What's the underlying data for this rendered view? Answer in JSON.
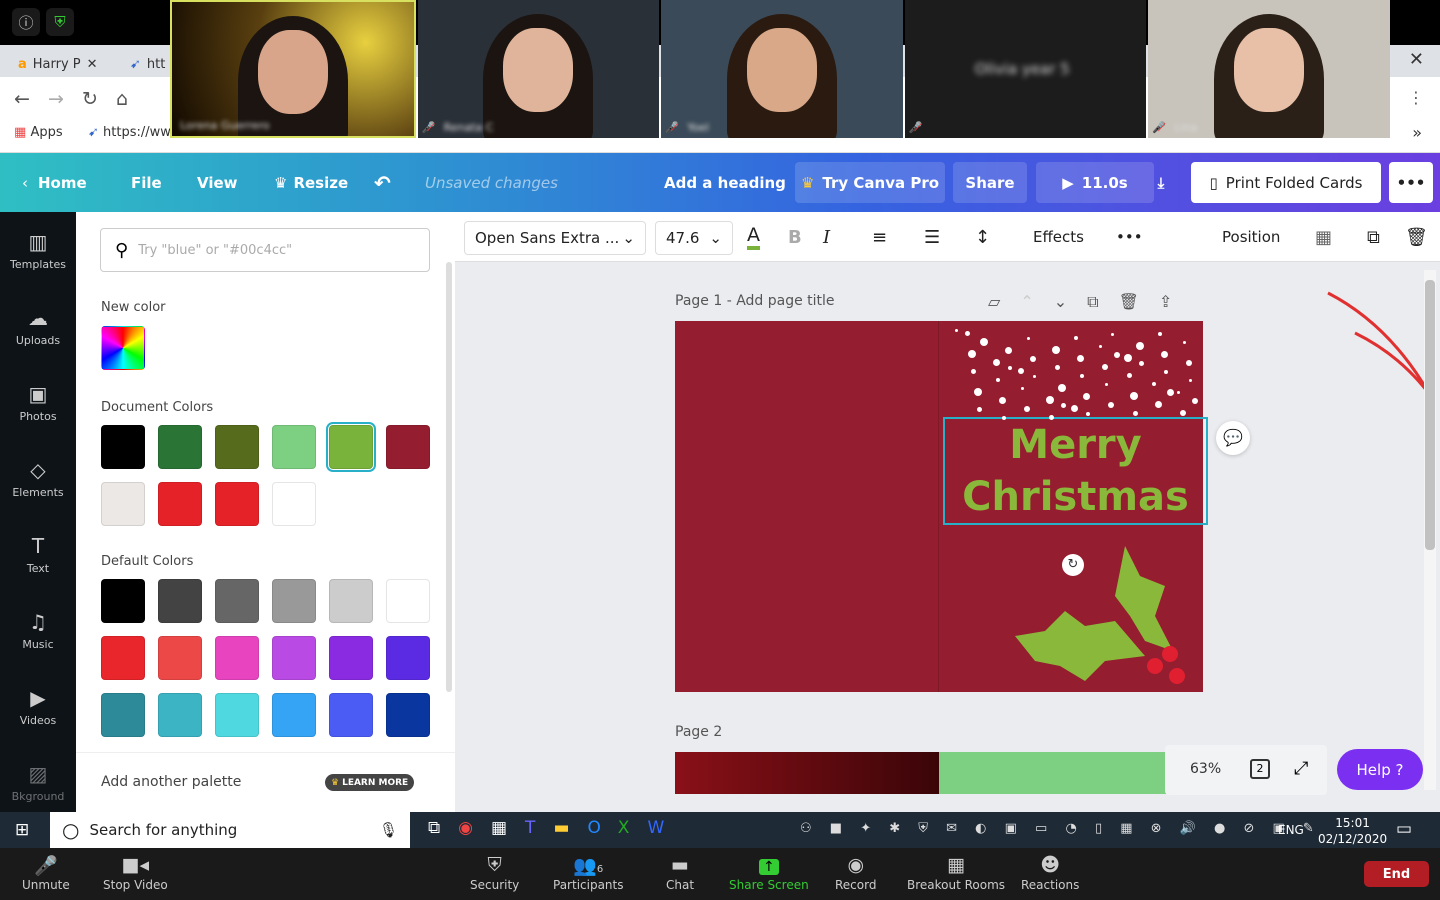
{
  "zoom_top": {
    "info_icon": "info-icon",
    "shield_icon": "shield-check-icon"
  },
  "videos": [
    {
      "name": "Lorena Guerrero"
    },
    {
      "name": "Renata C"
    },
    {
      "name": "Yoel"
    },
    {
      "name": "Olivia year 5"
    },
    {
      "name": "Lina"
    }
  ],
  "browser": {
    "tabs": [
      {
        "label": "Harry P"
      },
      {
        "label": "htt"
      }
    ],
    "url": "https://ww",
    "bookmarks": [
      {
        "label": "Apps"
      },
      {
        "label": "https://ww"
      }
    ]
  },
  "canva_header": {
    "home": "Home",
    "file": "File",
    "view": "View",
    "resize": "Resize",
    "status": "Unsaved changes",
    "heading": "Add a heading",
    "try_pro": "Try Canva Pro",
    "share": "Share",
    "duration": "11.0s",
    "print": "Print Folded Cards",
    "more": "•••"
  },
  "leftnav": [
    {
      "label": "Templates",
      "icon": "▥"
    },
    {
      "label": "Uploads",
      "icon": "☁"
    },
    {
      "label": "Photos",
      "icon": "▣"
    },
    {
      "label": "Elements",
      "icon": "◇"
    },
    {
      "label": "Text",
      "icon": "T"
    },
    {
      "label": "Music",
      "icon": "♫"
    },
    {
      "label": "Videos",
      "icon": "▶"
    },
    {
      "label": "Bkground",
      "icon": "▨"
    }
  ],
  "panel": {
    "search_placeholder": "Try \"blue\" or \"#00c4cc\"",
    "new_color": "New color",
    "document_colors": "Document Colors",
    "default_colors": "Default Colors",
    "add_palette": "Add another palette",
    "learn_more": "LEARN MORE",
    "doc_swatches": [
      "#000000",
      "#2a7536",
      "#566b1c",
      "#7dcf82",
      "#7ab33c",
      "#941d2f",
      "#ece8e6",
      "#e62229",
      "#e62229",
      "#ffffff"
    ],
    "default_swatches": [
      "#000000",
      "#434343",
      "#666666",
      "#999999",
      "#cccccc",
      "#ffffff",
      "#e8262b",
      "#ec4848",
      "#e844c0",
      "#b94be4",
      "#8a2be2",
      "#5b2be4",
      "#2d8a99",
      "#3cb4c4",
      "#4fd8e0",
      "#35a4f4",
      "#4a5cf4",
      "#0a36a0"
    ]
  },
  "toolbar": {
    "font": "Open Sans Extra ...",
    "size": "47.6",
    "effects": "Effects",
    "position": "Position",
    "more": "•••"
  },
  "canvas": {
    "page1_title": "Page 1 - Add page title",
    "page2_title": "Page 2",
    "text_line1": "Merry",
    "text_line2": "Christmas",
    "zoom": "63%",
    "pages": "2",
    "help": "Help ?"
  },
  "taskbar": {
    "search": "Search for anything",
    "lang": "ENG",
    "time": "15:01",
    "date": "02/12/2020"
  },
  "zoombar": {
    "unmute": "Unmute",
    "stop_video": "Stop Video",
    "security": "Security",
    "participants": "Participants",
    "participants_count": "6",
    "chat": "Chat",
    "share": "Share Screen",
    "record": "Record",
    "breakout": "Breakout Rooms",
    "reactions": "Reactions",
    "end": "End"
  }
}
